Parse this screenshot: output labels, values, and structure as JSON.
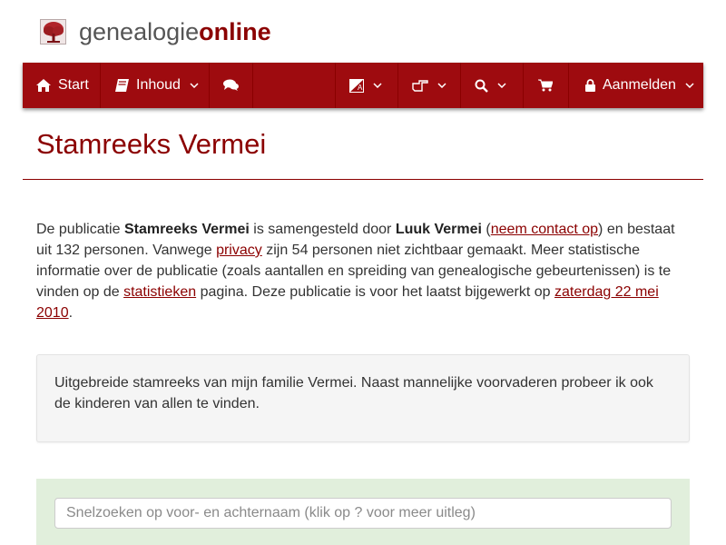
{
  "logo": {
    "text_a": "genealogie",
    "text_b": "online"
  },
  "nav": {
    "start": "Start",
    "inhoud": "Inhoud",
    "login": "Aanmelden"
  },
  "page_title": "Stamreeks Vermei",
  "intro": {
    "t1": "De publicatie ",
    "pub": "Stamreeks Vermei",
    "t2": " is samengesteld door ",
    "author": "Luuk Vermei",
    "t3": " (",
    "contact": "neem contact op",
    "t4": ") en bestaat uit 132 personen. Vanwege ",
    "privacy": "privacy",
    "t5": " zijn 54 personen niet zichtbaar gemaakt. Meer statistische informatie over de publicatie (zoals aantallen en spreiding van genealogische gebeurtenissen) is te vinden op de ",
    "stats": "statistieken",
    "t6": " pagina. Deze publicatie is voor het laatst bijgewerkt op ",
    "date": "zaterdag 22 mei 2010",
    "t7": "."
  },
  "description": "Uitgebreide stamreeks van mijn familie Vermei. Naast mannelijke voorvaderen probeer ik ook de kinderen van allen te vinden.",
  "search": {
    "placeholder": "Snelzoeken op voor- en achternaam (klik op ? voor meer uitleg)"
  },
  "colors": {
    "brand": "#9e0b0f",
    "title": "#8b0000",
    "search_bg": "#e1efdc"
  },
  "icons": [
    "home-icon",
    "book-icon",
    "comments-icon",
    "language-icon",
    "hand-pointer-icon",
    "search-icon",
    "cart-icon",
    "lock-icon",
    "chevron-down-icon"
  ]
}
